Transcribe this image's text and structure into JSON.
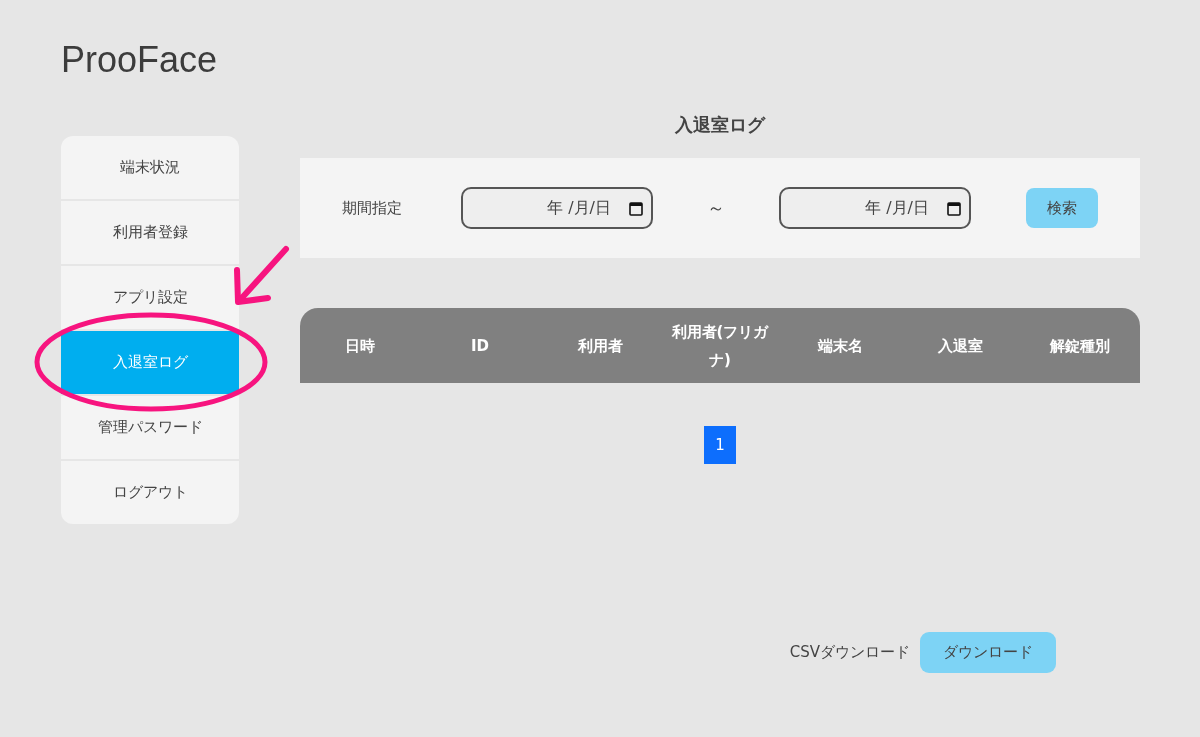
{
  "app": {
    "logo": "ProoFace"
  },
  "sidebar": {
    "items": [
      {
        "label": "端末状況",
        "selected": false
      },
      {
        "label": "利用者登録",
        "selected": false
      },
      {
        "label": "アプリ設定",
        "selected": false
      },
      {
        "label": "入退室ログ",
        "selected": true
      },
      {
        "label": "管理パスワード",
        "selected": false
      },
      {
        "label": "ログアウト",
        "selected": false
      }
    ]
  },
  "page_title": "入退室ログ",
  "filter": {
    "label": "期間指定",
    "from": {
      "value": "年 /月/日"
    },
    "separator": "～",
    "to": {
      "value": "年 /月/日"
    },
    "search_button": "検索"
  },
  "table": {
    "columns": [
      "日時",
      "ID",
      "利用者",
      "利用者(フリガナ)",
      "端末名",
      "入退室",
      "解錠種別"
    ]
  },
  "pagination": {
    "pages": [
      {
        "label": "1",
        "selected": true
      }
    ]
  },
  "download": {
    "label": "CSVダウンロード",
    "button": "ダウンロード"
  }
}
